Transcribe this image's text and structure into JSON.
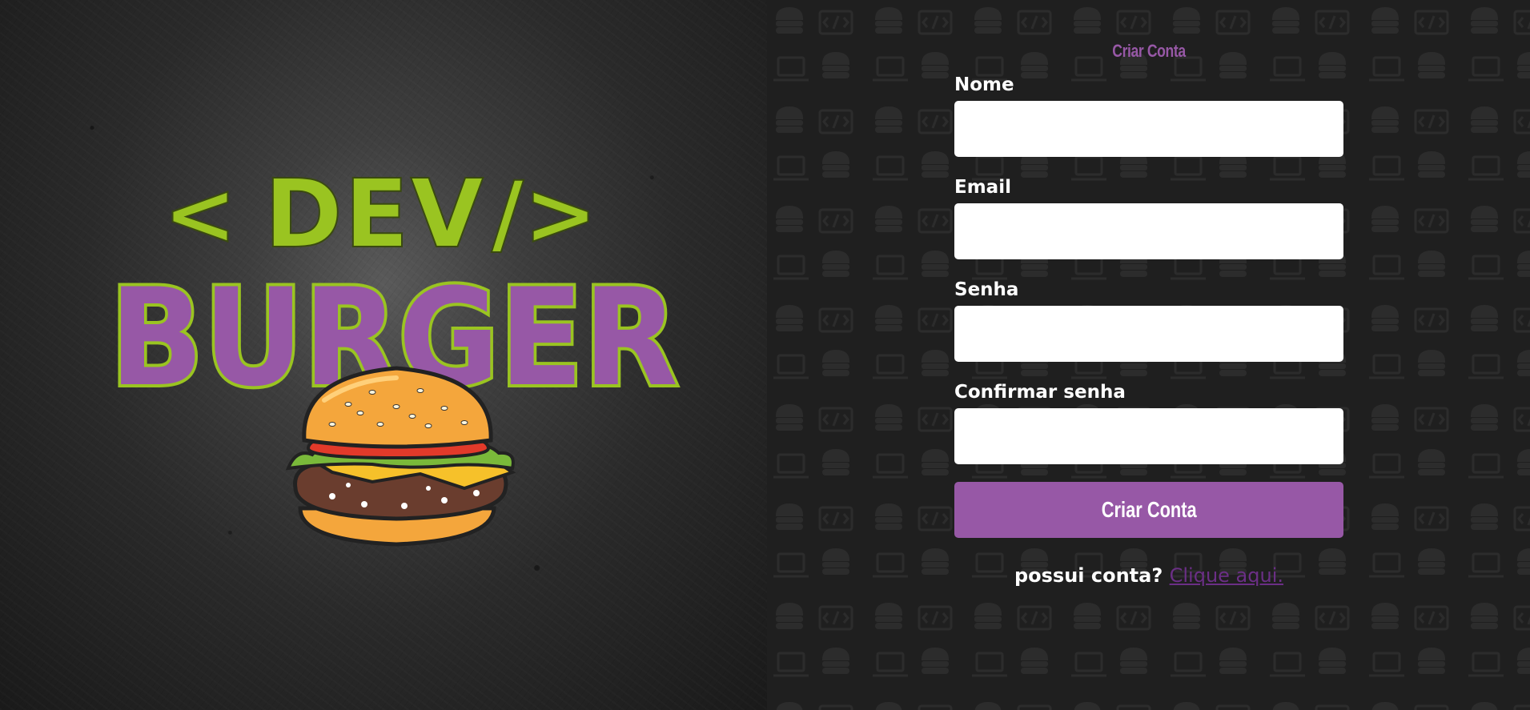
{
  "brand": {
    "code_open": "<",
    "code_word": "DEV",
    "code_close": "/>",
    "word": "BURGER",
    "colors": {
      "green": "#9ac421",
      "purple": "#9758a6",
      "outline": "#2b2b2b"
    }
  },
  "form": {
    "title": "Criar Conta",
    "fields": [
      {
        "label": "Nome",
        "value": "",
        "type": "text"
      },
      {
        "label": "Email",
        "value": "",
        "type": "email"
      },
      {
        "label": "Senha",
        "value": "",
        "type": "password"
      },
      {
        "label": "Confirmar senha",
        "value": "",
        "type": "password"
      }
    ],
    "submit_label": "Criar Conta",
    "login_prompt": "possui conta?",
    "login_link": "Clique aqui."
  },
  "icons": {
    "burger": "burger-icon",
    "laptop": "laptop-icon",
    "code": "code-icon"
  },
  "theme": {
    "accent": "#9758a6",
    "panel_bg": "#1f1f1f",
    "input_bg": "#ffffff",
    "link": "#6b2f86"
  }
}
